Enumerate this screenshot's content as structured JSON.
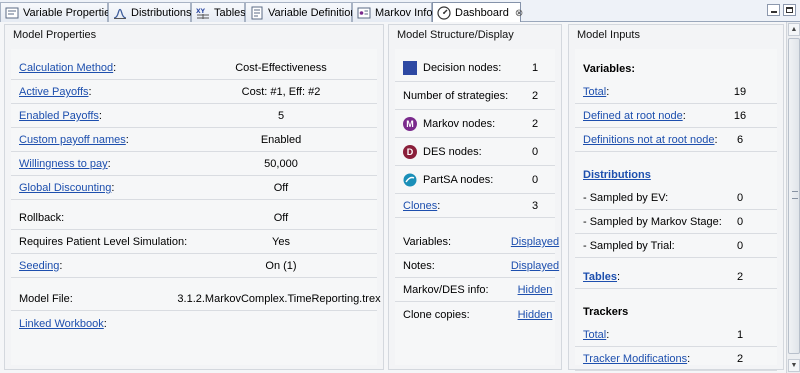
{
  "tabs": [
    {
      "label": "Variable Properties",
      "icon": "variable-properties-icon"
    },
    {
      "label": "Distributions",
      "icon": "distributions-icon"
    },
    {
      "label": "Tables",
      "icon": "tables-icon"
    },
    {
      "label": "Variable Definitions",
      "icon": "variable-definitions-icon"
    },
    {
      "label": "Markov Info",
      "icon": "markov-info-icon"
    },
    {
      "label": "Dashboard",
      "icon": "dashboard-icon",
      "active": true,
      "close": "⊗"
    }
  ],
  "model_properties": {
    "title": "Model Properties",
    "rows": [
      {
        "label": "Calculation Method",
        "colon": ":",
        "value": "Cost-Effectiveness"
      },
      {
        "label": "Active Payoffs",
        "colon": ":",
        "value": "Cost: #1, Eff: #2"
      },
      {
        "label": "Enabled Payoffs",
        "colon": ":",
        "value": "5"
      },
      {
        "label": "Custom payoff names",
        "colon": ":",
        "value": "Enabled"
      },
      {
        "label": "Willingness to pay",
        "colon": ":",
        "value": "50,000"
      },
      {
        "label": "Global Discounting",
        "colon": ":",
        "value": "Off"
      },
      {
        "label": "Rollback:",
        "value": "Off"
      },
      {
        "label": "Requires Patient Level Simulation:",
        "value": "Yes"
      },
      {
        "label": "Seeding",
        "colon": ":",
        "value": "On (1)"
      },
      {
        "label": "Model File:",
        "value": "3.1.2.MarkovComplex.TimeReporting.trex"
      },
      {
        "label": "Linked Workbook",
        "colon": ":",
        "value": ""
      }
    ]
  },
  "model_structure": {
    "title": "Model Structure/Display",
    "decision_nodes": {
      "label": "Decision nodes:",
      "value": "1"
    },
    "strategies": {
      "label": "Number of strategies:",
      "value": "2"
    },
    "markov_nodes": {
      "label": "Markov nodes:",
      "value": "2",
      "glyph": "M"
    },
    "des_nodes": {
      "label": "DES nodes:",
      "value": "0",
      "glyph": "D"
    },
    "partsa_nodes": {
      "label": "PartSA nodes:",
      "value": "0"
    },
    "clones": {
      "label": "Clones",
      "colon": ":",
      "value": "3"
    },
    "variables": {
      "label": "Variables:",
      "value": "Displayed"
    },
    "notes": {
      "label": "Notes:",
      "value": "Displayed"
    },
    "markov_des_info": {
      "label": "Markov/DES info:",
      "value": "Hidden"
    },
    "clone_copies": {
      "label": "Clone copies:",
      "value": "Hidden"
    },
    "colors": {
      "decision": "#2d49a3",
      "markov": "#7a2a8c",
      "des": "#8a1f3a",
      "partsa": "#1a8fb8"
    }
  },
  "model_inputs": {
    "title": "Model Inputs",
    "variables_heading": "Variables:",
    "total": {
      "label": "Total",
      "colon": ":",
      "value": "19"
    },
    "defined_root": {
      "label": "Defined at root node",
      "colon": ":",
      "value": "16"
    },
    "not_root": {
      "label": "Definitions not at root node",
      "colon": ":",
      "value": "6"
    },
    "distributions_heading": "Distributions",
    "sampled_ev": {
      "label": "- Sampled by EV:",
      "value": "0"
    },
    "sampled_markov": {
      "label": "- Sampled by Markov Stage:",
      "value": "0"
    },
    "sampled_trial": {
      "label": "- Sampled by Trial:",
      "value": "0"
    },
    "tables": {
      "label": "Tables",
      "colon": ":",
      "value": "2"
    },
    "trackers_heading": "Trackers",
    "trackers_total": {
      "label": "Total",
      "colon": ":",
      "value": "1"
    },
    "tracker_mods": {
      "label": "Tracker Modifications",
      "colon": ":",
      "value": "2"
    }
  }
}
